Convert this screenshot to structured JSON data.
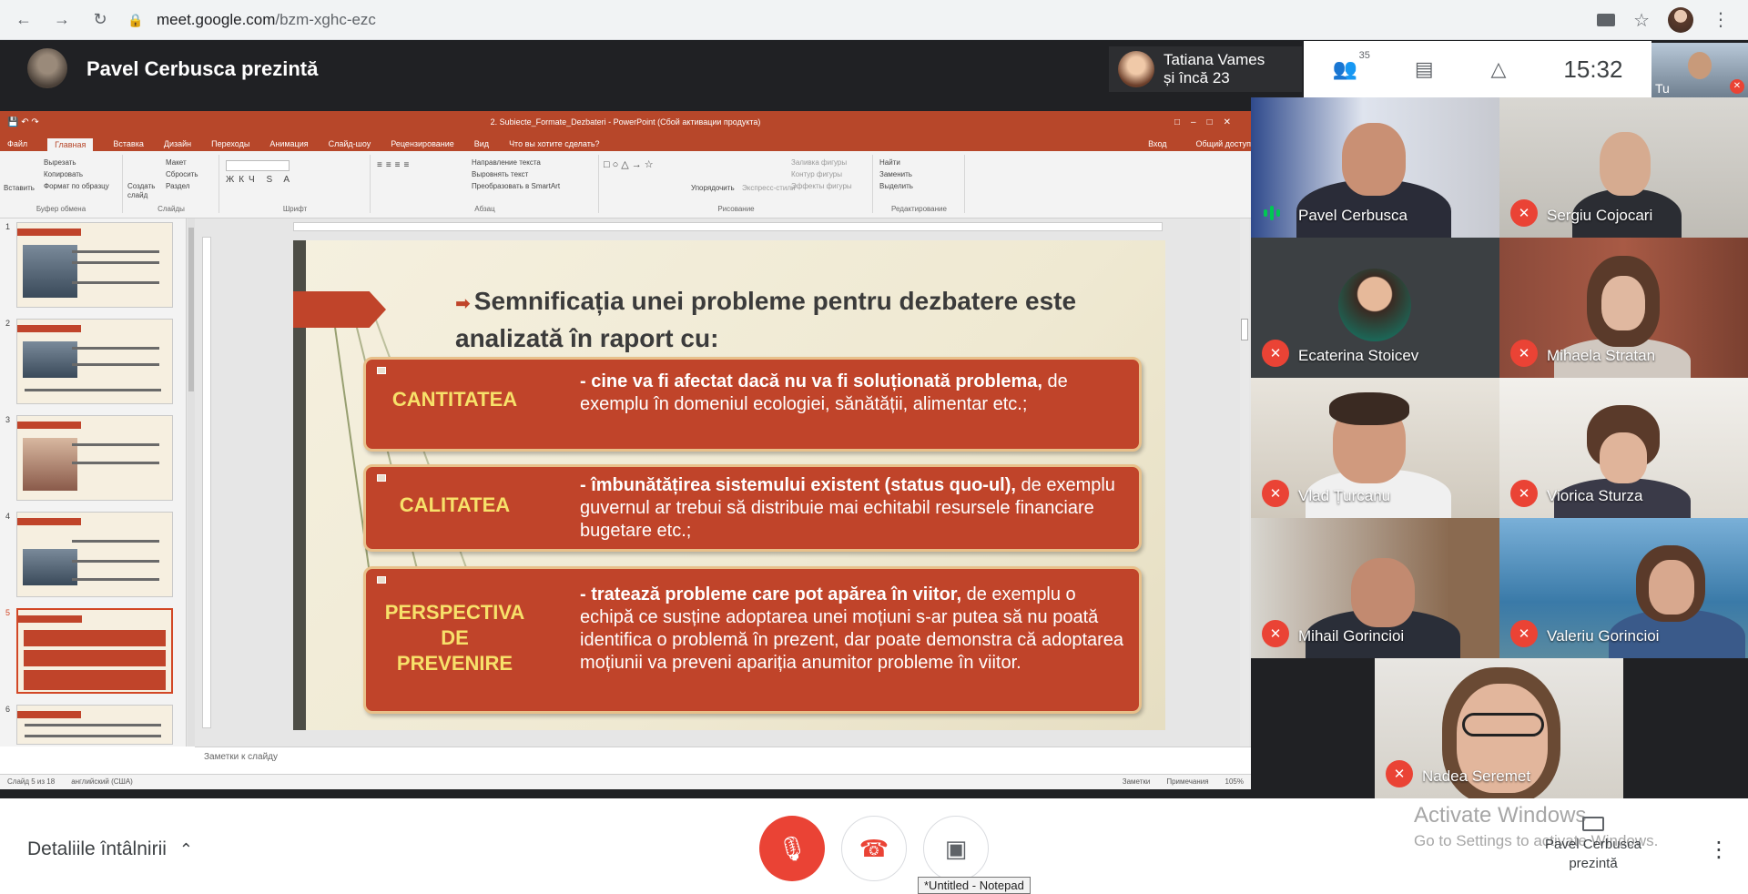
{
  "browser": {
    "url_host": "meet.google.com",
    "url_path": "/bzm-xghc-ezc"
  },
  "meet": {
    "presenting_title": "Pavel Cerbusca prezintă",
    "others_line1": "Tatiana Vames",
    "others_line2": "și încă 23",
    "participants_count": "35",
    "clock": "15:32",
    "self_label": "Tu"
  },
  "ppt": {
    "title": "2. Subiecte_Formate_Dezbateri - PowerPoint (Сбой активации продукта)",
    "tabs": [
      "Файл",
      "Главная",
      "Вставка",
      "Дизайн",
      "Переходы",
      "Анимация",
      "Слайд-шоу",
      "Рецензирование",
      "Вид",
      "Что вы хотите сделать?"
    ],
    "sign_in": "Вход",
    "share": "Общий доступ",
    "ribbon": {
      "clipboard": [
        "Вырезать",
        "Копировать",
        "Формат по образцу"
      ],
      "paste": "Вставить",
      "clipboard_name": "Буфер обмена",
      "slides": [
        "Макет",
        "Сбросить",
        "Раздел"
      ],
      "new_slide": "Создать слайд",
      "slides_name": "Слайды",
      "font_name": "Шрифт",
      "paragraph_name": "Абзац",
      "paragraph": [
        "Направление текста",
        "Выровнять текст",
        "Преобразовать в SmartArt"
      ],
      "drawing_name": "Рисование",
      "arrange": "Упорядочить",
      "quick_styles": "Экспресс-стили",
      "shape_fmt": [
        "Заливка фигуры",
        "Контур фигуры",
        "Эффекты фигуры"
      ],
      "editing": [
        "Найти",
        "Заменить",
        "Выделить"
      ],
      "editing_name": "Редактирование"
    },
    "notes_placeholder": "Заметки к слайду",
    "status_left": "Слайд 5 из 18",
    "status_lang": "английский (США)",
    "status_notes": "Заметки",
    "status_comments": "Примечания",
    "zoom": "105%",
    "thumb_numbers": [
      "1",
      "2",
      "3",
      "4",
      "5",
      "6"
    ]
  },
  "slide": {
    "heading": "Semnificația unei probleme pentru dezbatere este analizată în raport cu:",
    "boxes": [
      {
        "label": "CANTITATEA",
        "bold": "- cine va fi afectat dacă nu va fi soluționată problema,",
        "rest": " de exemplu în domeniul ecologiei, sănătății, alimentar etc.;"
      },
      {
        "label": "CALITATEA",
        "bold": "- îmbunătățirea sistemului existent (status quo-ul),",
        "rest": " de exemplu guvernul ar trebui să distribuie mai echitabil resursele financiare bugetare etc.;"
      },
      {
        "label": "PERSPECTIVA DE PREVENIRE",
        "bold": "- tratează probleme care pot apărea în viitor,",
        "rest": " de exemplu o echipă ce susține adoptarea unei moțiuni s-ar putea să nu poată identifica o problemă în prezent, dar poate demonstra că adoptarea moțiunii va preveni apariția anumitor probleme în viitor."
      }
    ]
  },
  "participants": [
    {
      "name": "Pavel Cerbusca",
      "muted": false,
      "speaking": true
    },
    {
      "name": "Sergiu Cojocari",
      "muted": true
    },
    {
      "name": "Ecaterina Stoicev",
      "muted": true
    },
    {
      "name": "Mihaela Stratan",
      "muted": true
    },
    {
      "name": "Vlad Țurcanu",
      "muted": true
    },
    {
      "name": "Viorica Sturza",
      "muted": true
    },
    {
      "name": "Mihail Gorincioi",
      "muted": true
    },
    {
      "name": "Valeriu Gorincioi",
      "muted": true
    },
    {
      "name": "Nadea Seremet",
      "muted": true
    }
  ],
  "bottom": {
    "details": "Detaliile întâlnirii",
    "tooltip": "*Untitled - Notepad",
    "activate_title": "Activate Windows",
    "activate_sub": "Go to Settings to activate Windows.",
    "present_line1": "Pavel Cerbusca",
    "present_line2": "prezintă"
  },
  "colors": {
    "accent_red": "#ea4335",
    "ppt_orange": "#b7472a",
    "slide_box": "#c0442a",
    "label_yellow": "#f7e16a",
    "speaking_green": "#00c853"
  }
}
